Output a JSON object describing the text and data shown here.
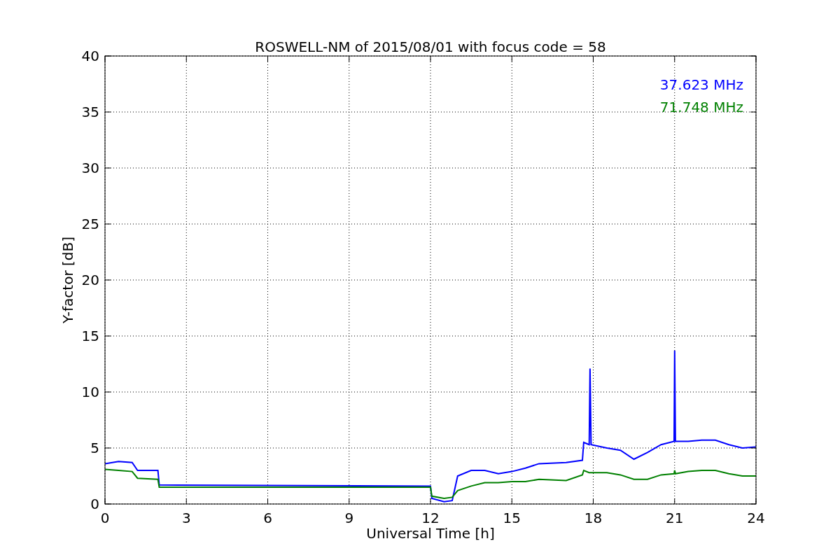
{
  "chart_data": {
    "type": "line",
    "title": "ROSWELL-NM of 2015/08/01 with focus code = 58",
    "xlabel": "Universal Time [h]",
    "ylabel": "Y-factor [dB]",
    "x": [
      0,
      0.5,
      1,
      1.2,
      1.95,
      2,
      12,
      12.05,
      12.5,
      12.8,
      13,
      13.5,
      14,
      14.5,
      15,
      15.5,
      16,
      17,
      17.6,
      17.65,
      17.85,
      17.88,
      17.92,
      18.5,
      19,
      19.5,
      20,
      20.5,
      20.98,
      21,
      21.03,
      21.5,
      22,
      22.5,
      23,
      23.5,
      24
    ],
    "series": [
      {
        "name": "37.623 MHz",
        "color": "#0000ff",
        "values": [
          3.6,
          3.8,
          3.7,
          3.0,
          3.0,
          1.7,
          1.6,
          0.5,
          0.2,
          0.3,
          2.5,
          3.0,
          3.0,
          2.7,
          2.9,
          3.2,
          3.6,
          3.7,
          3.9,
          5.5,
          5.3,
          12.1,
          5.3,
          5.0,
          4.8,
          4.0,
          4.6,
          5.3,
          5.6,
          13.7,
          5.6,
          5.6,
          5.7,
          5.7,
          5.3,
          5.0,
          5.1
        ]
      },
      {
        "name": "71.748 MHz",
        "color": "#008000",
        "values": [
          3.1,
          3.0,
          2.9,
          2.3,
          2.2,
          1.5,
          1.5,
          0.7,
          0.5,
          0.6,
          1.2,
          1.6,
          1.9,
          1.9,
          2.0,
          2.0,
          2.2,
          2.1,
          2.6,
          3.0,
          2.8,
          2.8,
          2.8,
          2.8,
          2.6,
          2.2,
          2.2,
          2.6,
          2.7,
          3.0,
          2.7,
          2.9,
          3.0,
          3.0,
          2.7,
          2.5,
          2.5
        ]
      }
    ],
    "grid": true,
    "xlim": [
      0,
      24
    ],
    "ylim": [
      0,
      40
    ],
    "xticks": [
      0,
      3,
      6,
      9,
      12,
      15,
      18,
      21,
      24
    ],
    "yticks": [
      0,
      5,
      10,
      15,
      20,
      25,
      30,
      35,
      40
    ]
  }
}
